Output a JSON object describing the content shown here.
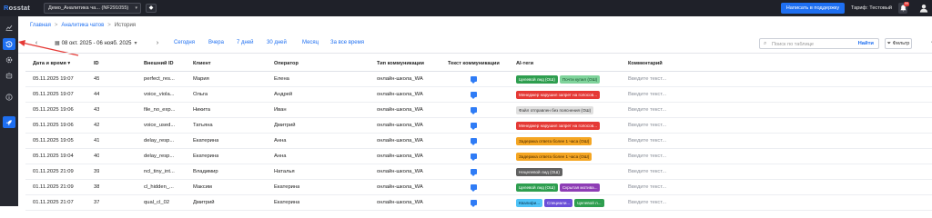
{
  "app": {
    "logo_main": "Rosstat",
    "project_select": "Демо_Аналитика ча... (NF291055)",
    "support_button": "Написать в поддержку",
    "tariff": "Тариф: Тестовый",
    "notification_count": "99"
  },
  "sidebar": {
    "items": [
      {
        "icon": "chart-icon"
      },
      {
        "icon": "history-icon",
        "active": true
      },
      {
        "icon": "gear-icon"
      },
      {
        "icon": "robot-icon"
      },
      {
        "icon": "info-icon"
      },
      {
        "icon": "rocket-icon",
        "active": true
      }
    ]
  },
  "breadcrumb": {
    "home": "Главная",
    "analytics": "Аналитика чатов",
    "current": "История"
  },
  "toolbar": {
    "date_range": "08 окт. 2025 - 06 нояб. 2025",
    "quick_filters": [
      "Сегодня",
      "Вчера",
      "7 дней",
      "30 дней",
      "Месяц",
      "За все время"
    ],
    "search_placeholder": "Поиск по таблице",
    "search_button": "Найти",
    "filter_button": "Фильтр",
    "more": "···"
  },
  "table": {
    "headers": {
      "date": "Дата и время",
      "id": "ID",
      "external_id": "Внешний ID",
      "client": "Клиент",
      "operator": "Оператор",
      "comm_type": "Тип коммуникации",
      "comm_text": "Текст коммуникации",
      "ai_tags": "AI-теги",
      "comment": "Комментарий"
    },
    "sort_indicator": "▾",
    "rows": [
      {
        "date": "05.11.2025 19:07",
        "id": "45",
        "ext": "perfect_res...",
        "client": "Мария",
        "operator": "Елена",
        "type": "онлайн-школа_WA",
        "tags": [
          {
            "text": "Целевой лид (ОШ)",
            "bg": "#2e9e4f",
            "fg": "#ffffff"
          },
          {
            "text": "Почти купил (ОШ)",
            "bg": "#7fd39b",
            "fg": "#14532d"
          }
        ],
        "comment": "Введите текст..."
      },
      {
        "date": "05.11.2025 19:07",
        "id": "44",
        "ext": "voice_viola...",
        "client": "Ольга",
        "operator": "Андрей",
        "type": "онлайн-школа_WA",
        "tags": [
          {
            "text": "Менеджер нарушил запрет на голосов...",
            "bg": "#e53935",
            "fg": "#ffffff"
          }
        ],
        "comment": "Введите текст..."
      },
      {
        "date": "05.11.2025 19:06",
        "id": "43",
        "ext": "file_no_exp...",
        "client": "Никита",
        "operator": "Иван",
        "type": "онлайн-школа_WA",
        "tags": [
          {
            "text": "Файл отправлен без пояснения (ОШ)",
            "bg": "#e0e0e0",
            "fg": "#333333"
          }
        ],
        "comment": "Введите текст..."
      },
      {
        "date": "05.11.2025 19:06",
        "id": "42",
        "ext": "voice_used...",
        "client": "Татьяна",
        "operator": "Дмитрий",
        "type": "онлайн-школа_WA",
        "tags": [
          {
            "text": "Менеджер нарушил запрет на голосов...",
            "bg": "#e53935",
            "fg": "#ffffff"
          }
        ],
        "comment": "Введите текст..."
      },
      {
        "date": "05.11.2025 19:05",
        "id": "41",
        "ext": "delay_resp...",
        "client": "Екатерина",
        "operator": "Анна",
        "type": "онлайн-школа_WA",
        "tags": [
          {
            "text": "Задержка ответа более 1 часа (ОШ)",
            "bg": "#f5a623",
            "fg": "#4a2a00"
          }
        ],
        "comment": "Введите текст..."
      },
      {
        "date": "05.11.2025 19:04",
        "id": "40",
        "ext": "delay_resp...",
        "client": "Екатерина",
        "operator": "Анна",
        "type": "онлайн-школа_WA",
        "tags": [
          {
            "text": "Задержка ответа более 1 часа (ОШ)",
            "bg": "#f5a623",
            "fg": "#4a2a00"
          }
        ],
        "comment": "Введите текст..."
      },
      {
        "date": "01.11.2025 21:09",
        "id": "39",
        "ext": "ncl_tiny_int...",
        "client": "Владимир",
        "operator": "Наталья",
        "type": "онлайн-школа_WA",
        "tags": [
          {
            "text": "Нецелевой лид (ОШ)",
            "bg": "#616161",
            "fg": "#ffffff"
          }
        ],
        "comment": "Введите текст..."
      },
      {
        "date": "01.11.2025 21:09",
        "id": "38",
        "ext": "cl_hidden_...",
        "client": "Максим",
        "operator": "Екатерина",
        "type": "онлайн-школа_WA",
        "tags": [
          {
            "text": "Целевой лид (ОШ)",
            "bg": "#2e9e4f",
            "fg": "#ffffff"
          },
          {
            "text": "Скрытая мотива...",
            "bg": "#8e3db5",
            "fg": "#ffffff"
          }
        ],
        "comment": "Введите текст..."
      },
      {
        "date": "01.11.2025 21:07",
        "id": "37",
        "ext": "qual_cl_02",
        "client": "Дмитрий",
        "operator": "Екатерина",
        "type": "онлайн-школа_WA",
        "tags": [
          {
            "text": "Квалифи...",
            "bg": "#4fc3f7",
            "fg": "#08304a"
          },
          {
            "text": "Специали...",
            "bg": "#6a4fd8",
            "fg": "#ffffff"
          },
          {
            "text": "Целевой л...",
            "bg": "#2e9e4f",
            "fg": "#ffffff"
          }
        ],
        "comment": "Введите текст..."
      }
    ]
  }
}
